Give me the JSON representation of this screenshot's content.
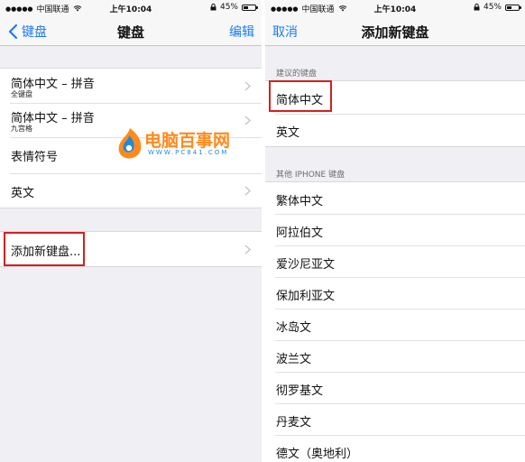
{
  "left": {
    "status": {
      "carrier": "中国联通",
      "time": "上午10:04",
      "battery": "45%",
      "battery_level": 0.45
    },
    "nav": {
      "back_label": "键盘",
      "title": "键盘",
      "edit_label": "编辑"
    },
    "keyboards": [
      {
        "title": "简体中文 – 拼音",
        "subtitle": "全键盘"
      },
      {
        "title": "简体中文 – 拼音",
        "subtitle": "九宫格"
      },
      {
        "title": "表情符号",
        "subtitle": ""
      },
      {
        "title": "英文",
        "subtitle": ""
      }
    ],
    "add_keyboard_label": "添加新键盘..."
  },
  "right": {
    "status": {
      "carrier": "中国联通",
      "time": "上午10:04",
      "battery": "45%",
      "battery_level": 0.45
    },
    "nav": {
      "cancel_label": "取消",
      "title": "添加新键盘"
    },
    "suggested_header": "建议的键盘",
    "suggested": [
      "简体中文",
      "英文"
    ],
    "other_header": "其他 IPHONE 键盘",
    "others": [
      "繁体中文",
      "阿拉伯文",
      "爱沙尼亚文",
      "保加利亚文",
      "冰岛文",
      "波兰文",
      "彻罗基文",
      "丹麦文",
      "德文（奥地利）"
    ]
  },
  "watermark": {
    "brand": "电脑百事网",
    "url": "WWW.PC841.COM"
  },
  "colors": {
    "accent": "#1a7cf3",
    "highlight": "#d51f1f",
    "watermark_orange": "#ff8a1c",
    "watermark_blue": "#1a8be0"
  },
  "icons": {
    "back": "chevron-left-icon",
    "row": "chevron-right-icon",
    "wifi": "wifi-icon",
    "battery": "battery-icon",
    "lock": "rotation-lock-icon"
  }
}
